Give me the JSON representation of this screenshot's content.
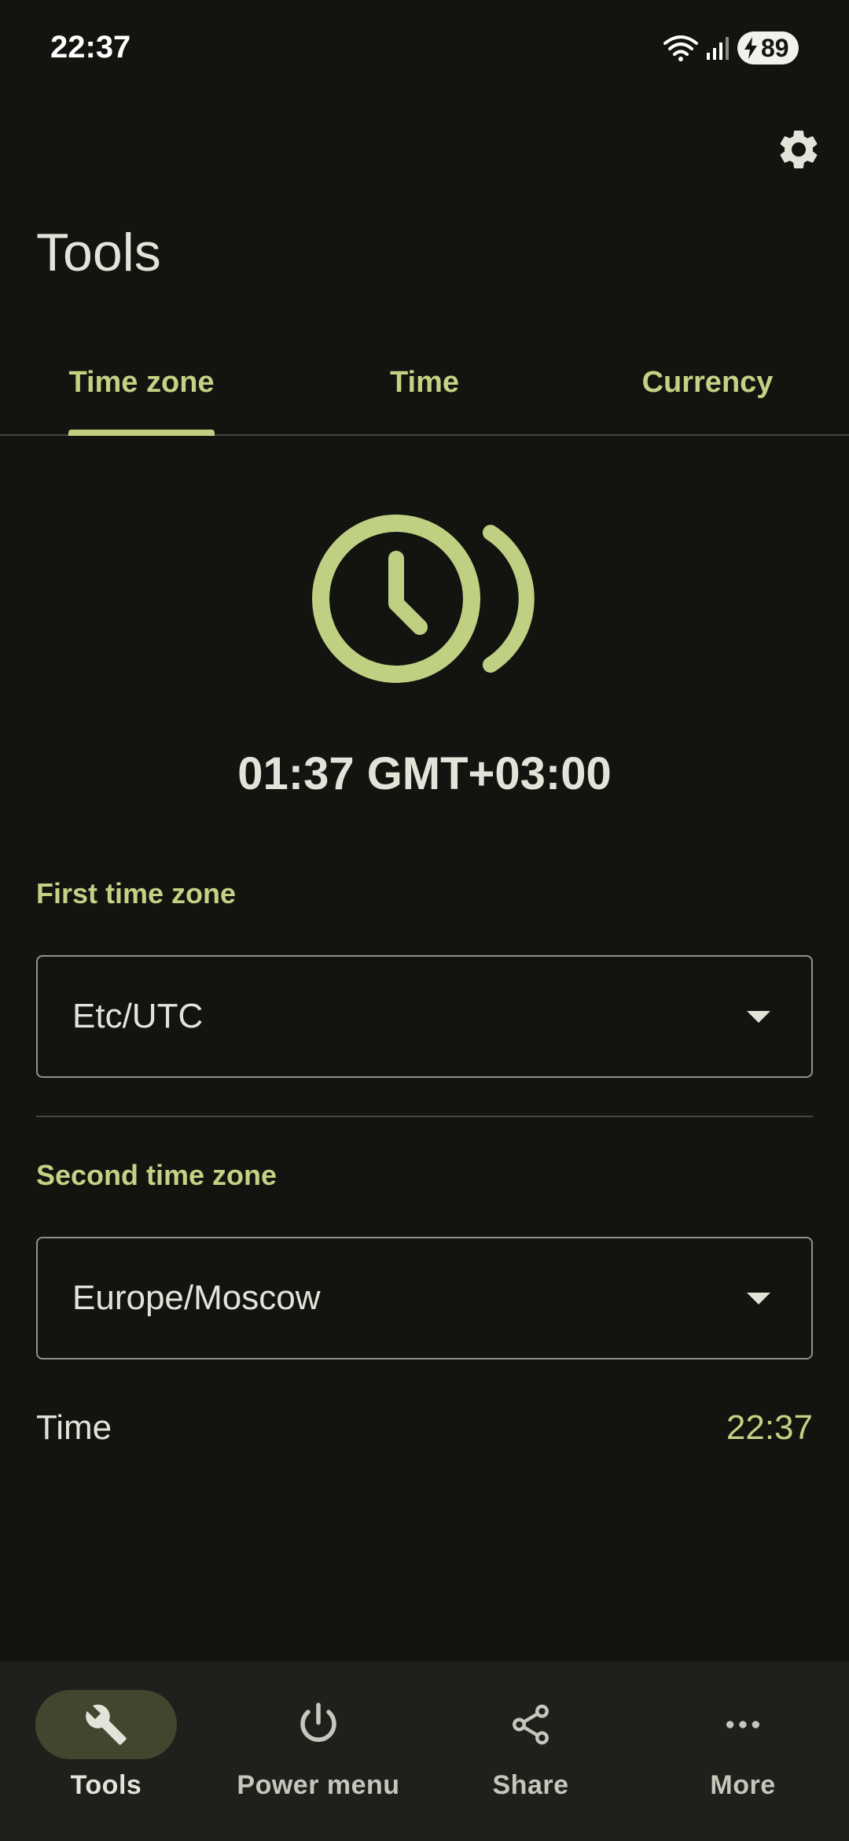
{
  "status_bar": {
    "time": "22:37",
    "battery_level": "89"
  },
  "header": {
    "title": "Tools"
  },
  "tabs": [
    {
      "label": "Time zone",
      "active": true
    },
    {
      "label": "Time",
      "active": false
    },
    {
      "label": "Currency",
      "active": false
    }
  ],
  "hero": {
    "time_display": "01:37 GMT+03:00"
  },
  "form": {
    "first_zone_label": "First time zone",
    "first_zone_value": "Etc/UTC",
    "second_zone_label": "Second time zone",
    "second_zone_value": "Europe/Moscow",
    "time_label": "Time",
    "time_value": "22:37"
  },
  "bottom_nav": [
    {
      "label": "Tools",
      "icon": "wrench-icon",
      "active": true
    },
    {
      "label": "Power menu",
      "icon": "power-icon",
      "active": false
    },
    {
      "label": "Share",
      "icon": "share-icon",
      "active": false
    },
    {
      "label": "More",
      "icon": "more-horiz-icon",
      "active": false
    }
  ],
  "colors": {
    "background": "#131410",
    "accent": "#c3d285",
    "nav_background": "#1f201b",
    "nav_active_pill": "#41472f"
  }
}
